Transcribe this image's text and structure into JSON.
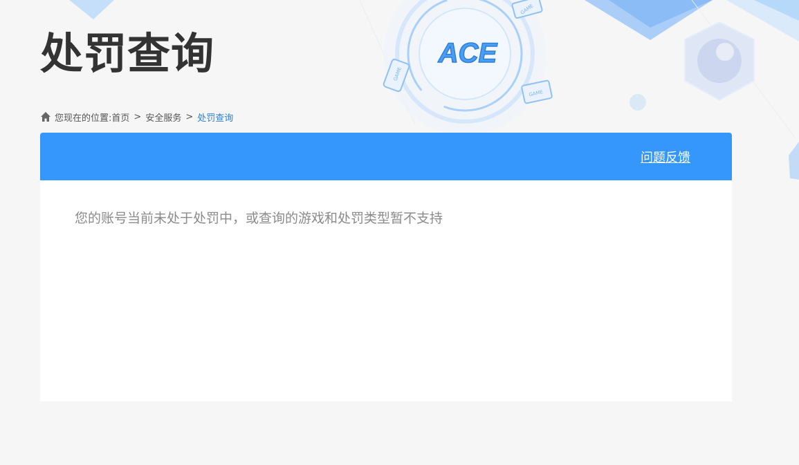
{
  "page": {
    "title": "处罚查询",
    "logo_text": "ACE"
  },
  "breadcrumb": {
    "prefix": "您现在的位置:",
    "items": [
      "首页",
      "安全服务",
      "处罚查询"
    ],
    "separator": ">"
  },
  "panel": {
    "feedback_label": "问题反馈",
    "message": "您的账号当前未处于处罚中，或查询的游戏和处罚类型暂不支持"
  },
  "decor": {
    "game_tag_1": "GAME",
    "game_tag_2": "GAME",
    "game_tag_3": "GAME"
  },
  "colors": {
    "accent": "#3596fb",
    "title": "#333333",
    "current_crumb": "#2b7fd9",
    "background": "#f6f6f6"
  }
}
